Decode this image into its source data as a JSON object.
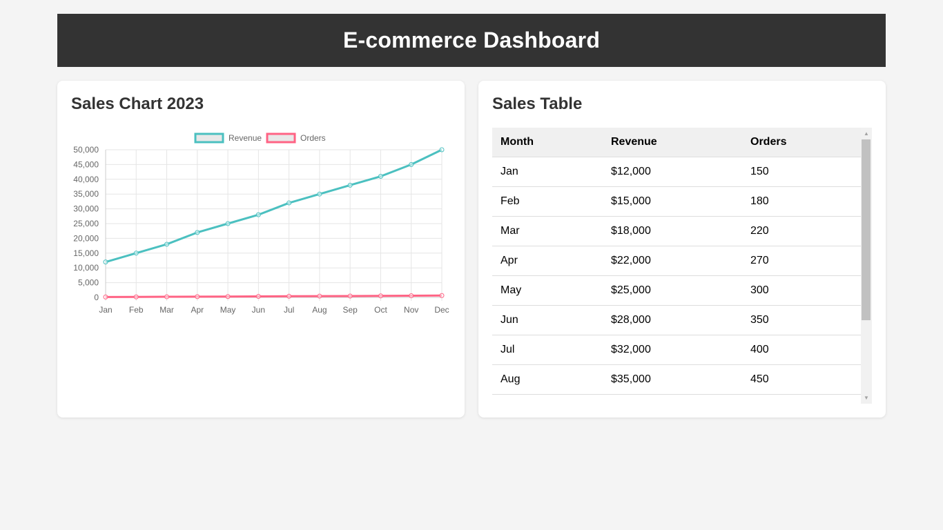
{
  "header": {
    "title": "E-commerce Dashboard"
  },
  "chart_card": {
    "title": "Sales Chart 2023"
  },
  "table_card": {
    "title": "Sales Table"
  },
  "colors": {
    "revenue": "#4bc0c0",
    "orders": "#ff6384",
    "header_bg": "#333333"
  },
  "chart_data": {
    "type": "line",
    "categories": [
      "Jan",
      "Feb",
      "Mar",
      "Apr",
      "May",
      "Jun",
      "Jul",
      "Aug",
      "Sep",
      "Oct",
      "Nov",
      "Dec"
    ],
    "series": [
      {
        "name": "Revenue",
        "values": [
          12000,
          15000,
          18000,
          22000,
          25000,
          28000,
          32000,
          35000,
          38000,
          41000,
          45000,
          50000
        ]
      },
      {
        "name": "Orders",
        "values": [
          150,
          180,
          220,
          270,
          300,
          350,
          400,
          450,
          480,
          520,
          580,
          650
        ]
      }
    ],
    "ylim": [
      0,
      50000
    ],
    "yticks": [
      "0",
      "5,000",
      "10,000",
      "15,000",
      "20,000",
      "25,000",
      "30,000",
      "35,000",
      "40,000",
      "45,000",
      "50,000"
    ],
    "legend": "top-center",
    "grid": true
  },
  "table": {
    "headers": [
      "Month",
      "Revenue",
      "Orders"
    ],
    "rows": [
      [
        "Jan",
        "$12,000",
        "150"
      ],
      [
        "Feb",
        "$15,000",
        "180"
      ],
      [
        "Mar",
        "$18,000",
        "220"
      ],
      [
        "Apr",
        "$22,000",
        "270"
      ],
      [
        "May",
        "$25,000",
        "300"
      ],
      [
        "Jun",
        "$28,000",
        "350"
      ],
      [
        "Jul",
        "$32,000",
        "400"
      ],
      [
        "Aug",
        "$35,000",
        "450"
      ]
    ]
  }
}
